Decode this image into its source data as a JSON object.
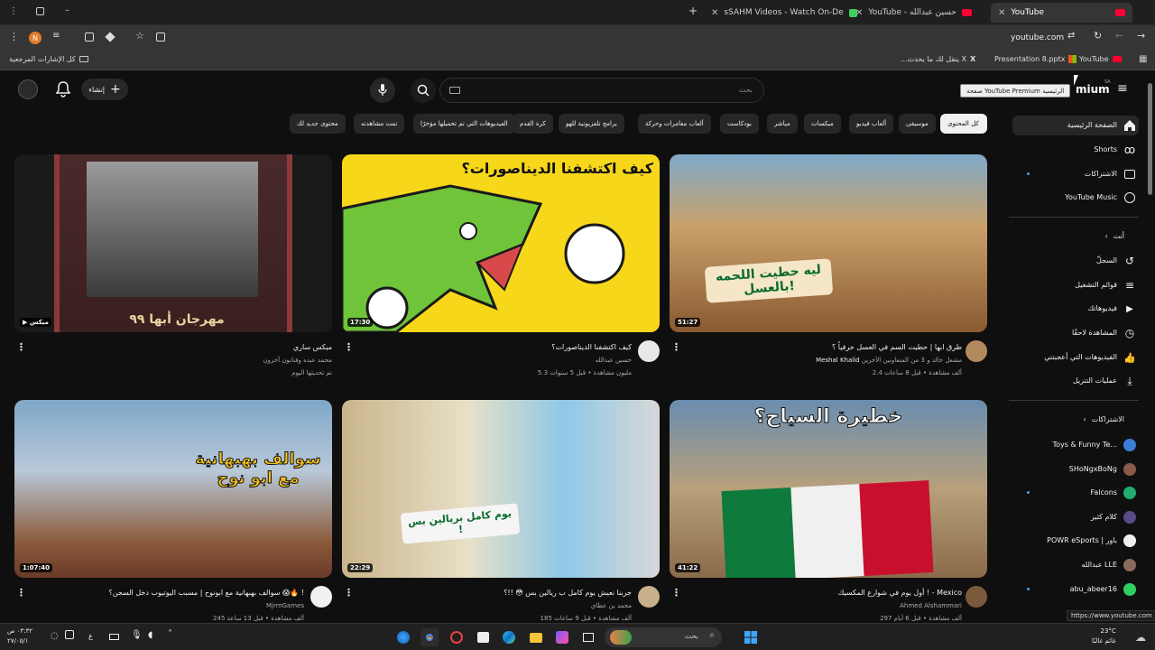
{
  "browser": {
    "tabs": [
      {
        "label": "sSAHM Videos - Watch On-De"
      },
      {
        "label": "YouTube - حسين عبدالله"
      },
      {
        "label": "YouTube"
      }
    ],
    "address": "youtube.com",
    "bookmarks": {
      "all_bookmarks": "كل الإشارات المرجعية",
      "x_item": "...ينقل لك ما يحدث X",
      "pptx": "Presentation 8.pptx",
      "youtube": "YouTube"
    },
    "profile_letter": "N"
  },
  "header": {
    "create_label": "إنشاء",
    "search_placeholder": "بحث",
    "premium_fragment": "mium",
    "region": "SA",
    "tooltip": "صفحة YouTube Premium الرئيسية"
  },
  "chips": [
    {
      "label": "كل المحتوى",
      "selected": true
    },
    {
      "label": "موسيقى"
    },
    {
      "label": "ألعاب فيديو"
    },
    {
      "label": "ميكسات"
    },
    {
      "label": "مباشر"
    },
    {
      "label": "بودكاست"
    },
    {
      "label": "ألعاب مغامرات وحركة"
    },
    {
      "label": "برامج تلفزيونية للهو"
    },
    {
      "label": "كرة القدم"
    },
    {
      "label": "الفيديوهات التي تم تحميلها مؤخرًا"
    },
    {
      "label": "تمت مشاهدته"
    },
    {
      "label": "محتوى جديد لك"
    }
  ],
  "videos": [
    {
      "title": "طرق ابها | حطيت السم في العسل حرفياً ؟",
      "channel": "Meshal Khalid",
      "channel_extra": "مشعل خالد و 3 من المتعاونين الآخرين",
      "meta": "2.4 ألف مشاهدة • قبل 8 ساعات",
      "duration": "51:27",
      "thumb_text": "ليه حطيت اللحمه بالعسل!"
    },
    {
      "title": "كيف اكتشفنا الديناصورات؟",
      "channel": "حسين عبدالله",
      "meta": "5.3 مليون مشاهدة • قبل 5 سنوات",
      "duration": "17:30",
      "thumb_text": "كيف اكتشفنا الديناصورات؟"
    },
    {
      "title": "ميكس ساري",
      "channel": "محمد عبده وفنانون آخرون",
      "meta": "تم تحديثها اليوم",
      "duration": "ميكس",
      "thumb_text": "مهرجان أبها ٩٩"
    },
    {
      "title": "أول يوم في شوارع المكسيك ! - Mexico",
      "channel": "Ahmed Alshammari",
      "meta": "297 ألف مشاهدة • قبل 6 أيام",
      "duration": "41:22",
      "thumb_text": "خطيرة السياح؟"
    },
    {
      "title": "جربنا نعيش يوم كامل ب ريالين بس 😳 !!؟",
      "channel": "محمد بن عطاي",
      "meta": "185 ألف مشاهدة • قبل 9 ساعات",
      "duration": "22:29",
      "thumb_text": "يوم كامل بريالين بس !"
    },
    {
      "title": "سوالف بهبهانية مع ابونوح | مسبب اليوتيوب دخل السجن؟ 😱🔥 !",
      "channel": "MjrmGames",
      "meta": "245 ألف مشاهدة • قبل 13 ساعة",
      "duration": "1:07:40",
      "thumb_text": "سوالف بهبهانية مع ابو نوح"
    }
  ],
  "sidebar": {
    "main": [
      {
        "label": "الصفحة الرئيسية"
      },
      {
        "label": "Shorts"
      },
      {
        "label": "الاشتراكات"
      },
      {
        "label": "YouTube Music"
      }
    ],
    "you_header": "أنت",
    "you": [
      {
        "label": "السجلّ"
      },
      {
        "label": "قوائم التشغيل"
      },
      {
        "label": "فيديوهاتك"
      },
      {
        "label": "المشاهدة لاحقًا"
      },
      {
        "label": "الفيديوهات التي أعجبتني"
      },
      {
        "label": "عمليات التنزيل"
      }
    ],
    "subs_header": "الاشتراكات",
    "subs": [
      {
        "label": "Toys & Funny Te...",
        "color": "#3b7dd8"
      },
      {
        "label": "SHoNgxBoNg",
        "color": "#8a5a4a"
      },
      {
        "label": "Falcons",
        "color": "#1fae6f"
      },
      {
        "label": "كلام كثير",
        "color": "#5a4a8a"
      },
      {
        "label": "POWR eSports | باور",
        "color": "#eeeeee"
      },
      {
        "label": "عبدالله LLE",
        "color": "#8a6a5a"
      },
      {
        "label": "abu_abeer16",
        "color": "#2fcf5f"
      }
    ]
  },
  "status_url": "https://www.youtube.com",
  "taskbar": {
    "time": "٠٣:٣٢ ص",
    "date": "٢٧/٠٥/١",
    "lang": "ع",
    "search": "بحث",
    "weather_temp": "23°C",
    "weather_desc": "غائم غالبًا"
  }
}
